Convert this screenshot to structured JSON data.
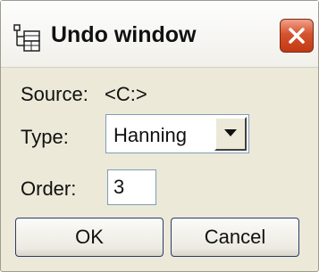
{
  "window": {
    "title": "Undo window",
    "title_icon": "tree-structure-icon",
    "close_icon": "close-icon"
  },
  "source": {
    "label": "Source:",
    "value": "<C:>"
  },
  "type": {
    "label": "Type:",
    "selected": "Hanning",
    "arrow_icon": "chevron-down-icon"
  },
  "order": {
    "label": "Order:",
    "value": "3"
  },
  "buttons": {
    "ok_label": "OK",
    "cancel_label": "Cancel"
  },
  "colors": {
    "dialog_background": "#ece9d8",
    "close_button": "#d4532e",
    "field_border": "#7f9db9",
    "button_border": "#2b3c6b"
  }
}
